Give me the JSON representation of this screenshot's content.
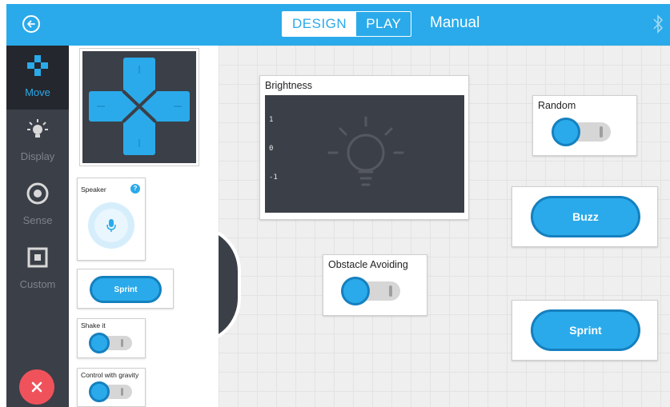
{
  "header": {
    "back_icon": "back-arrow-icon",
    "modes": [
      "DESIGN",
      "PLAY"
    ],
    "active_mode": "DESIGN",
    "title": "Manual",
    "bluetooth_icon": "bluetooth-icon",
    "accent": "#2aaaea"
  },
  "sidebar": {
    "items": [
      {
        "label": "Move",
        "icon": "gamepad-icon",
        "active": true
      },
      {
        "label": "Display",
        "icon": "lightbulb-icon",
        "active": false
      },
      {
        "label": "Sense",
        "icon": "sensor-icon",
        "active": false
      },
      {
        "label": "Custom",
        "icon": "custom-square-icon",
        "active": false
      }
    ],
    "close_icon": "close-icon",
    "close_color": "#f0525c"
  },
  "palette": {
    "speaker": {
      "title": "Speaker",
      "help": "?"
    },
    "sprint": {
      "label": "Sprint"
    },
    "shake": {
      "title": "Shake it"
    },
    "gravity": {
      "title": "Control with gravity"
    }
  },
  "canvas": {
    "brightness": {
      "title": "Brightness",
      "ticks": [
        "1",
        "0",
        "-1"
      ]
    },
    "random": {
      "title": "Random"
    },
    "buzz": {
      "label": "Buzz"
    },
    "obstacle": {
      "title": "Obstacle Avoiding"
    },
    "sprint": {
      "label": "Sprint"
    }
  }
}
